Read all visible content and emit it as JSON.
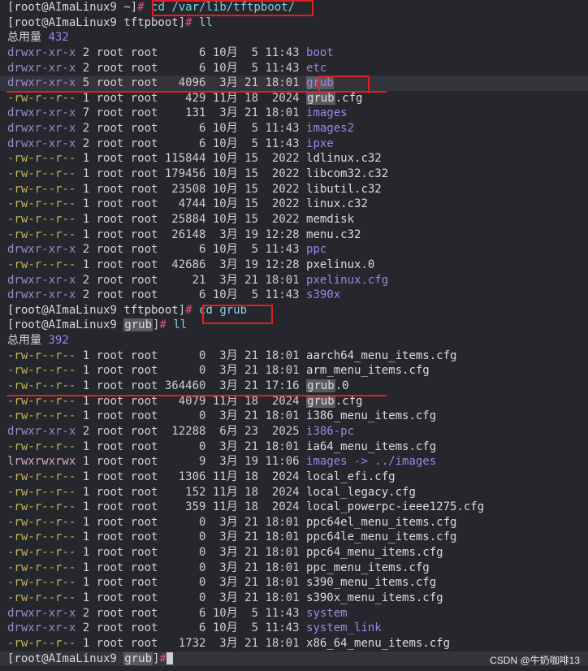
{
  "prompts": [
    {
      "user": "[root@AImaLinux9 ~]",
      "hash": "#",
      "cmd": "cd /var/lib/tftpboot/"
    },
    {
      "user": "[root@AImaLinux9 tftpboot]",
      "hash": "#",
      "cmd": "ll"
    },
    {
      "user": "[root@AImaLinux9 tftpboot]",
      "hash": "#",
      "cmd": "cd grub"
    },
    {
      "user_pre": "[root@AImaLinux9 ",
      "user_dir": "grub",
      "user_post": "]",
      "hash": "#",
      "cmd": "ll"
    },
    {
      "user_pre": "[root@AImaLinux9 ",
      "user_dir": "grub",
      "user_post": "]",
      "hash": "#",
      "cmd": ""
    }
  ],
  "listing1": {
    "total_label": "总用量",
    "total_value": "432",
    "rows": [
      {
        "perm": "drwxr-xr-x",
        "links": "2",
        "owner": "root",
        "group": "root",
        "size": "6",
        "month": "10月",
        "day": "5",
        "time": "11:43",
        "name": "boot",
        "kind": "dir"
      },
      {
        "perm": "drwxr-xr-x",
        "links": "2",
        "owner": "root",
        "group": "root",
        "size": "6",
        "month": "10月",
        "day": "5",
        "time": "11:43",
        "name": "etc",
        "kind": "dir"
      },
      {
        "perm": "drwxr-xr-x",
        "links": "5",
        "owner": "root",
        "group": "root",
        "size": "4096",
        "month": "3月",
        "day": "21",
        "time": "18:01",
        "name": "grub",
        "kind": "dir"
      },
      {
        "perm": "-rw-r--r--",
        "links": "1",
        "owner": "root",
        "group": "root",
        "size": "429",
        "month": "11月",
        "day": "18",
        "time": "2024",
        "name": "grub.cfg",
        "kind": "file"
      },
      {
        "perm": "drwxr-xr-x",
        "links": "7",
        "owner": "root",
        "group": "root",
        "size": "131",
        "month": "3月",
        "day": "21",
        "time": "18:01",
        "name": "images",
        "kind": "dir"
      },
      {
        "perm": "drwxr-xr-x",
        "links": "2",
        "owner": "root",
        "group": "root",
        "size": "6",
        "month": "10月",
        "day": "5",
        "time": "11:43",
        "name": "images2",
        "kind": "dir"
      },
      {
        "perm": "drwxr-xr-x",
        "links": "2",
        "owner": "root",
        "group": "root",
        "size": "6",
        "month": "10月",
        "day": "5",
        "time": "11:43",
        "name": "ipxe",
        "kind": "dir"
      },
      {
        "perm": "-rw-r--r--",
        "links": "1",
        "owner": "root",
        "group": "root",
        "size": "115844",
        "month": "10月",
        "day": "15",
        "time": "2022",
        "name": "ldlinux.c32",
        "kind": "file"
      },
      {
        "perm": "-rw-r--r--",
        "links": "1",
        "owner": "root",
        "group": "root",
        "size": "179456",
        "month": "10月",
        "day": "15",
        "time": "2022",
        "name": "libcom32.c32",
        "kind": "file"
      },
      {
        "perm": "-rw-r--r--",
        "links": "1",
        "owner": "root",
        "group": "root",
        "size": "23508",
        "month": "10月",
        "day": "15",
        "time": "2022",
        "name": "libutil.c32",
        "kind": "file"
      },
      {
        "perm": "-rw-r--r--",
        "links": "1",
        "owner": "root",
        "group": "root",
        "size": "4744",
        "month": "10月",
        "day": "15",
        "time": "2022",
        "name": "linux.c32",
        "kind": "file"
      },
      {
        "perm": "-rw-r--r--",
        "links": "1",
        "owner": "root",
        "group": "root",
        "size": "25884",
        "month": "10月",
        "day": "15",
        "time": "2022",
        "name": "memdisk",
        "kind": "file"
      },
      {
        "perm": "-rw-r--r--",
        "links": "1",
        "owner": "root",
        "group": "root",
        "size": "26148",
        "month": "3月",
        "day": "19",
        "time": "12:28",
        "name": "menu.c32",
        "kind": "file"
      },
      {
        "perm": "drwxr-xr-x",
        "links": "2",
        "owner": "root",
        "group": "root",
        "size": "6",
        "month": "10月",
        "day": "5",
        "time": "11:43",
        "name": "ppc",
        "kind": "dir"
      },
      {
        "perm": "-rw-r--r--",
        "links": "1",
        "owner": "root",
        "group": "root",
        "size": "42686",
        "month": "3月",
        "day": "19",
        "time": "12:28",
        "name": "pxelinux.0",
        "kind": "file"
      },
      {
        "perm": "drwxr-xr-x",
        "links": "2",
        "owner": "root",
        "group": "root",
        "size": "21",
        "month": "3月",
        "day": "21",
        "time": "18:01",
        "name": "pxelinux.cfg",
        "kind": "dir"
      },
      {
        "perm": "drwxr-xr-x",
        "links": "2",
        "owner": "root",
        "group": "root",
        "size": "6",
        "month": "10月",
        "day": "5",
        "time": "11:43",
        "name": "s390x",
        "kind": "dir"
      }
    ]
  },
  "listing2": {
    "total_label": "总用量",
    "total_value": "392",
    "rows": [
      {
        "perm": "-rw-r--r--",
        "links": "1",
        "owner": "root",
        "group": "root",
        "size": "0",
        "month": "3月",
        "day": "21",
        "time": "18:01",
        "name": "aarch64_menu_items.cfg",
        "kind": "file"
      },
      {
        "perm": "-rw-r--r--",
        "links": "1",
        "owner": "root",
        "group": "root",
        "size": "0",
        "month": "3月",
        "day": "21",
        "time": "18:01",
        "name": "arm_menu_items.cfg",
        "kind": "file"
      },
      {
        "perm": "-rw-r--r--",
        "links": "1",
        "owner": "root",
        "group": "root",
        "size": "364460",
        "month": "3月",
        "day": "21",
        "time": "17:16",
        "name": "grub.0",
        "kind": "file"
      },
      {
        "perm": "-rw-r--r--",
        "links": "1",
        "owner": "root",
        "group": "root",
        "size": "4079",
        "month": "11月",
        "day": "18",
        "time": "2024",
        "name": "grub.cfg",
        "kind": "file"
      },
      {
        "perm": "-rw-r--r--",
        "links": "1",
        "owner": "root",
        "group": "root",
        "size": "0",
        "month": "3月",
        "day": "21",
        "time": "18:01",
        "name": "i386_menu_items.cfg",
        "kind": "file"
      },
      {
        "perm": "drwxr-xr-x",
        "links": "2",
        "owner": "root",
        "group": "root",
        "size": "12288",
        "month": "6月",
        "day": "23",
        "time": "2025",
        "name": "i386-pc",
        "kind": "dir"
      },
      {
        "perm": "-rw-r--r--",
        "links": "1",
        "owner": "root",
        "group": "root",
        "size": "0",
        "month": "3月",
        "day": "21",
        "time": "18:01",
        "name": "ia64_menu_items.cfg",
        "kind": "file"
      },
      {
        "perm": "lrwxrwxrwx",
        "links": "1",
        "owner": "root",
        "group": "root",
        "size": "9",
        "month": "3月",
        "day": "19",
        "time": "11:06",
        "name": "images -> ../images",
        "kind": "link"
      },
      {
        "perm": "-rw-r--r--",
        "links": "1",
        "owner": "root",
        "group": "root",
        "size": "1306",
        "month": "11月",
        "day": "18",
        "time": "2024",
        "name": "local_efi.cfg",
        "kind": "file"
      },
      {
        "perm": "-rw-r--r--",
        "links": "1",
        "owner": "root",
        "group": "root",
        "size": "152",
        "month": "11月",
        "day": "18",
        "time": "2024",
        "name": "local_legacy.cfg",
        "kind": "file"
      },
      {
        "perm": "-rw-r--r--",
        "links": "1",
        "owner": "root",
        "group": "root",
        "size": "359",
        "month": "11月",
        "day": "18",
        "time": "2024",
        "name": "local_powerpc-ieee1275.cfg",
        "kind": "file"
      },
      {
        "perm": "-rw-r--r--",
        "links": "1",
        "owner": "root",
        "group": "root",
        "size": "0",
        "month": "3月",
        "day": "21",
        "time": "18:01",
        "name": "ppc64el_menu_items.cfg",
        "kind": "file"
      },
      {
        "perm": "-rw-r--r--",
        "links": "1",
        "owner": "root",
        "group": "root",
        "size": "0",
        "month": "3月",
        "day": "21",
        "time": "18:01",
        "name": "ppc64le_menu_items.cfg",
        "kind": "file"
      },
      {
        "perm": "-rw-r--r--",
        "links": "1",
        "owner": "root",
        "group": "root",
        "size": "0",
        "month": "3月",
        "day": "21",
        "time": "18:01",
        "name": "ppc64_menu_items.cfg",
        "kind": "file"
      },
      {
        "perm": "-rw-r--r--",
        "links": "1",
        "owner": "root",
        "group": "root",
        "size": "0",
        "month": "3月",
        "day": "21",
        "time": "18:01",
        "name": "ppc_menu_items.cfg",
        "kind": "file"
      },
      {
        "perm": "-rw-r--r--",
        "links": "1",
        "owner": "root",
        "group": "root",
        "size": "0",
        "month": "3月",
        "day": "21",
        "time": "18:01",
        "name": "s390_menu_items.cfg",
        "kind": "file"
      },
      {
        "perm": "-rw-r--r--",
        "links": "1",
        "owner": "root",
        "group": "root",
        "size": "0",
        "month": "3月",
        "day": "21",
        "time": "18:01",
        "name": "s390x_menu_items.cfg",
        "kind": "file"
      },
      {
        "perm": "drwxr-xr-x",
        "links": "2",
        "owner": "root",
        "group": "root",
        "size": "6",
        "month": "10月",
        "day": "5",
        "time": "11:43",
        "name": "system",
        "kind": "dir"
      },
      {
        "perm": "drwxr-xr-x",
        "links": "2",
        "owner": "root",
        "group": "root",
        "size": "6",
        "month": "10月",
        "day": "5",
        "time": "11:43",
        "name": "system_link",
        "kind": "dir"
      },
      {
        "perm": "-rw-r--r--",
        "links": "1",
        "owner": "root",
        "group": "root",
        "size": "1732",
        "month": "3月",
        "day": "21",
        "time": "18:01",
        "name": "x86_64_menu_items.cfg",
        "kind": "file"
      }
    ]
  },
  "watermark": "CSDN @牛奶咖啡13",
  "colors": {
    "background": "#26262d",
    "dir": "#9c86e8",
    "perm_file": "#c0b45a",
    "perm_dir": "#9a8ac8",
    "annotation": "#e02020",
    "command": "#7fd0e0",
    "hash": "#e0508a"
  }
}
